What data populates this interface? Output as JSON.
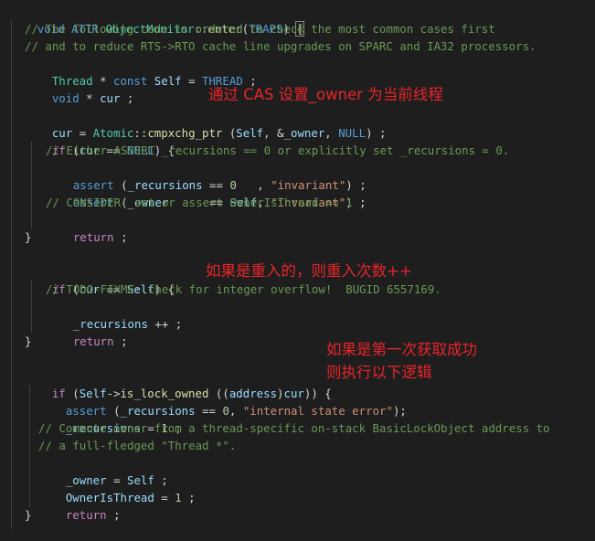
{
  "code": {
    "l1": {
      "a": "void",
      "b": "ATTR",
      "c": "ObjectMonitor",
      "d": "::",
      "e": "enter",
      "f": "(",
      "g": "TRAPS",
      "h": ") ",
      "i": "{"
    },
    "l2": "// The following code is ordered to check the most common cases first",
    "l3": "// and to reduce RTS->RTO cache line upgrades on SPARC and IA32 processors.",
    "l4": {
      "a": "Thread",
      "b": " * ",
      "c": "const",
      "d": " ",
      "e": "Self",
      "f": " = ",
      "g": "THREAD",
      "h": " ;"
    },
    "l5": {
      "a": "void",
      "b": " * ",
      "c": "cur",
      "d": " ;"
    },
    "l7": {
      "a": "cur",
      "b": " = ",
      "c": "Atomic",
      "d": "::",
      "e": "cmpxchg_ptr",
      "f": " (",
      "g": "Self",
      "h": ", &",
      "i": "_owner",
      "j": ", ",
      "k": "NULL",
      "l": ") ;"
    },
    "l8": {
      "a": "if",
      "b": " (",
      "c": "cur",
      "d": " == ",
      "e": "NULL",
      "f": ") {"
    },
    "l9": "// Either ASSERT _recursions == 0 or explicitly set _recursions = 0.",
    "l10": {
      "a": "assert",
      "b": " (",
      "c": "_recursions",
      "d": " == ",
      "e": "0",
      "f": "   , ",
      "g": "\"invariant\"",
      "h": ") ;"
    },
    "l11": {
      "a": "assert",
      "b": " (",
      "c": "_owner",
      "d": "      == ",
      "e": "Self",
      "f": ", ",
      "g": "\"invariant\"",
      "h": ") ;"
    },
    "l12": "// CONSIDER: set or assert OwnerIsThread == 1",
    "l13": {
      "a": "return",
      "b": " ;"
    },
    "l14": "}",
    "l16": {
      "a": "if",
      "b": " (",
      "c": "cur",
      "d": " == ",
      "e": "Self",
      "f": ") {"
    },
    "l17": "// TODO-FIXME: check for integer overflow!  BUGID 6557169.",
    "l18": {
      "a": "_recursions",
      "b": " ++ ;"
    },
    "l19": {
      "a": "return",
      "b": " ;"
    },
    "l20": "}",
    "l22": {
      "a": "if",
      "b": " (",
      "c": "Self",
      "d": "->",
      "e": "is_lock_owned",
      "f": " ((",
      "g": "address",
      "h": ")",
      "i": "cur",
      "j": ")) {"
    },
    "l23": {
      "a": "assert",
      "b": " (",
      "c": "_recursions",
      "d": " == ",
      "e": "0",
      "f": ", ",
      "g": "\"internal state error\"",
      "h": ");"
    },
    "l24": {
      "a": "_recursions",
      "b": " = ",
      "c": "1",
      "d": " ;"
    },
    "l25": "// Commute owner from a thread-specific on-stack BasicLockObject address to",
    "l26": "// a full-fledged \"Thread *\".",
    "l27": {
      "a": "_owner",
      "b": " = ",
      "c": "Self",
      "d": " ;"
    },
    "l28": {
      "a": "OwnerIsThread",
      "b": " = ",
      "c": "1",
      "d": " ;"
    },
    "l29": {
      "a": "return",
      "b": " ;"
    },
    "l30": "}"
  },
  "annotations": {
    "cas": "通过 CAS 设置_owner 为当前线程",
    "reentrant": "如果是重入的，则重入次数++",
    "first_line1": "如果是第一次获取成功",
    "first_line2": "则执行以下逻辑"
  }
}
